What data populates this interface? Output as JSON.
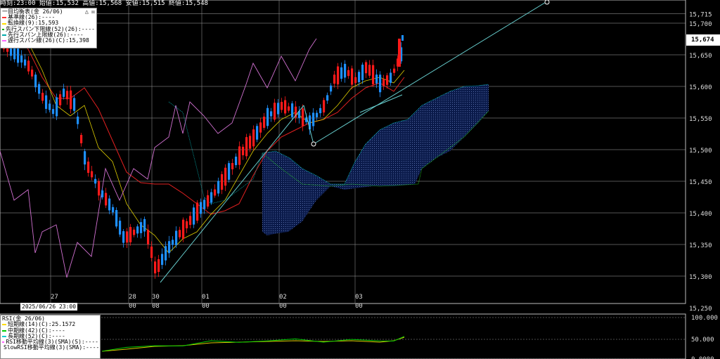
{
  "header": {
    "ohlc_text": "時刻:23:00 始値:15,532 高値:15,568 安値:15,515 終値:15,548"
  },
  "legend": {
    "title": "一目均衡表(金 26/06)",
    "items": [
      {
        "label": "基準線(26):----",
        "color": "#ff3333"
      },
      {
        "label": "転換線(9):15,593",
        "color": "#ffdd00"
      },
      {
        "label": "先行スパン下限線(52)(26):----",
        "color": "#00aa00"
      },
      {
        "label": "先行スパン上限線(26):----",
        "color": "#00aaaa"
      },
      {
        "label": "遅行スパン線(26)(C):15,398",
        "color": "#ff66ff"
      }
    ],
    "up_icon": "triangle-up-icon",
    "close_icon": "close-icon"
  },
  "price_axis": {
    "labels": [
      "15,715",
      "15,700",
      "15,650",
      "15,600",
      "15,550",
      "15,500",
      "15,450",
      "15,400",
      "15,350",
      "15,300",
      "15,250"
    ],
    "current": "15,674"
  },
  "time_axis": {
    "labels": [
      {
        "day": "27",
        "time": ""
      },
      {
        "day": "28",
        "time": "00"
      },
      {
        "day": "30",
        "time": "08"
      },
      {
        "day": "01",
        "time": "00"
      },
      {
        "day": "02",
        "time": "00"
      },
      {
        "day": "03",
        "time": "00"
      }
    ],
    "cursor_date": "2025/06/26 23:00"
  },
  "rsi": {
    "legend_title": "RSI(金 26/06)",
    "items": [
      {
        "label": "短期線(14)(C):25.1572",
        "color": "#ffdd00"
      },
      {
        "label": "中期線(42)(C):----",
        "color": "#00cc00"
      },
      {
        "label": "長期線(52)(C):----",
        "color": "#00cccc"
      },
      {
        "label": "RSI移動平均線(3)(SMA)(S):----",
        "color": "#ff66ff"
      },
      {
        "label": "SlowRSI移動平均線(3)(SMA):----",
        "color": "#ff3333"
      }
    ],
    "axis_labels": [
      "100.000",
      "50.000",
      "0.0000"
    ]
  },
  "colors": {
    "background": "#000000",
    "up_candle": "#ff1a1a",
    "down_candle": "#1e90ff",
    "kumo_fill": "#0a1a4a",
    "trendline": "#66cccc"
  }
}
